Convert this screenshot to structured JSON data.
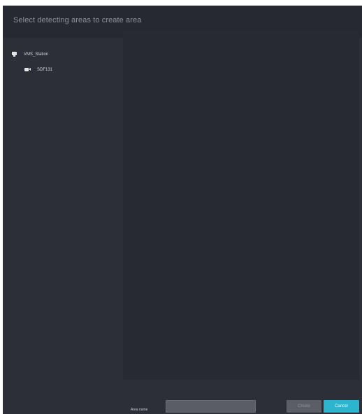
{
  "dialog": {
    "title": "Select detecting areas to create area"
  },
  "tree": {
    "station": {
      "label": "VMS_Station",
      "icon": "monitor-icon"
    },
    "camera": {
      "label": "SDF131",
      "icon": "camera-icon"
    }
  },
  "footer": {
    "area_name_label": "Area name",
    "area_name_value": "",
    "create_label": "Create",
    "cancel_label": "Cancel"
  },
  "colors": {
    "accent": "#2db5d0",
    "dialog_bg": "#2c2f37",
    "header_bg": "#262930",
    "preview_bg": "#272a31"
  }
}
